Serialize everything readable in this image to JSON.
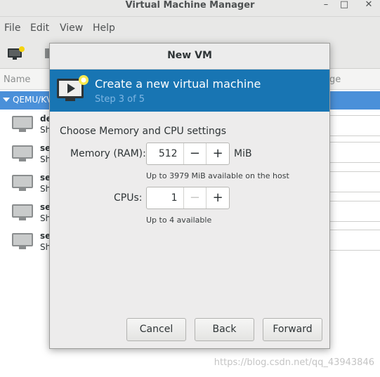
{
  "window": {
    "title": "Virtual Machine Manager",
    "minimize_glyph": "–",
    "maximize_glyph": "□",
    "close_glyph": "✕"
  },
  "menu": [
    "File",
    "Edit",
    "View",
    "Help"
  ],
  "list": {
    "header_name": "Name",
    "header_usage_partial": "ge",
    "group_label": "QEMU/KV",
    "rows": [
      {
        "name": "de",
        "state": "Sh"
      },
      {
        "name": "se",
        "state": "Sh"
      },
      {
        "name": "se",
        "state": "Sh"
      },
      {
        "name": "se",
        "state": "Sh"
      },
      {
        "name": "se",
        "state": "Sh"
      }
    ]
  },
  "dialog": {
    "title": "New VM",
    "banner": {
      "title": "Create a new virtual machine",
      "step": "Step 3 of 5"
    },
    "section_title": "Choose Memory and CPU settings",
    "memory": {
      "label": "Memory (RAM):",
      "value": "512",
      "unit": "MiB",
      "hint": "Up to 3979 MiB available on the host",
      "minus": "−",
      "plus": "+"
    },
    "cpus": {
      "label": "CPUs:",
      "value": "1",
      "hint": "Up to 4 available",
      "minus": "−",
      "plus": "+"
    },
    "buttons": {
      "cancel": "Cancel",
      "back": "Back",
      "forward": "Forward"
    }
  },
  "watermark": "https://blog.csdn.net/qq_43943846",
  "colors": {
    "banner": "#1875b3",
    "selection": "#4a90d9",
    "step_text": "#7fb6e3"
  },
  "icons": {
    "banner": "new-vm-icon",
    "vm": "monitor-icon"
  }
}
